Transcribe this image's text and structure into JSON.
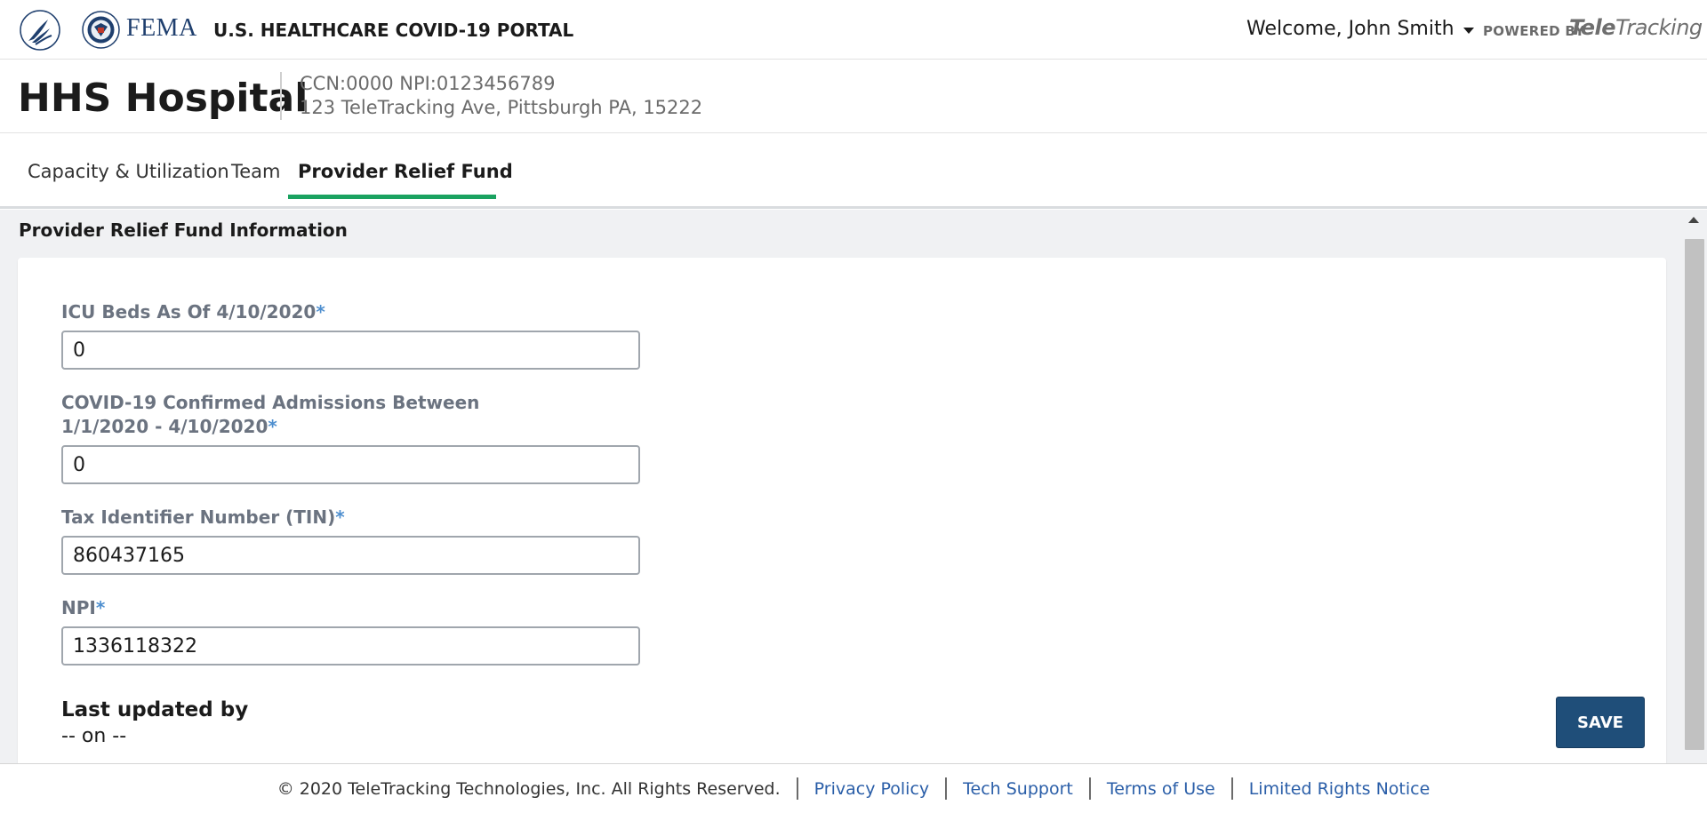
{
  "topbar": {
    "agency": "FEMA",
    "portal_title": "U.S. HEALTHCARE COVID-19 PORTAL",
    "welcome": "Welcome, John Smith",
    "powered_by": "POWERED BY",
    "brand_prefix": "Tele",
    "brand_suffix": "Tracking"
  },
  "hospital": {
    "name": "HHS Hospital",
    "ids": "CCN:0000 NPI:0123456789",
    "address": "123 TeleTracking Ave, Pittsburgh PA, 15222"
  },
  "tabs": [
    {
      "label": "Capacity & Utilization",
      "active": false
    },
    {
      "label": "Team",
      "active": false
    },
    {
      "label": "Provider Relief Fund",
      "active": true
    }
  ],
  "section": {
    "title": "Provider Relief Fund Information"
  },
  "form": {
    "icu_beds": {
      "label": "ICU Beds As Of 4/10/2020",
      "required": "*",
      "value": "0"
    },
    "covid_admissions": {
      "label_line1": "COVID-19 Confirmed Admissions Between",
      "label_line2": "1/1/2020 - 4/10/2020",
      "required": "*",
      "value": "0"
    },
    "tin": {
      "label": "Tax Identifier Number (TIN)",
      "required": "*",
      "value": "860437165"
    },
    "npi": {
      "label": "NPI",
      "required": "*",
      "value": "1336118322"
    },
    "last_updated_title": "Last updated by",
    "last_updated_on": "-- on --",
    "save_label": "SAVE"
  },
  "footer": {
    "copyright": "© 2020 TeleTracking Technologies, Inc. All Rights Reserved.",
    "links": [
      "Privacy Policy",
      "Tech Support",
      "Terms of Use",
      "Limited Rights Notice"
    ]
  },
  "colors": {
    "accent_tab": "#1aa260",
    "save_button": "#1f4e79",
    "link": "#2a5ea8",
    "required": "#4f8fcf"
  }
}
